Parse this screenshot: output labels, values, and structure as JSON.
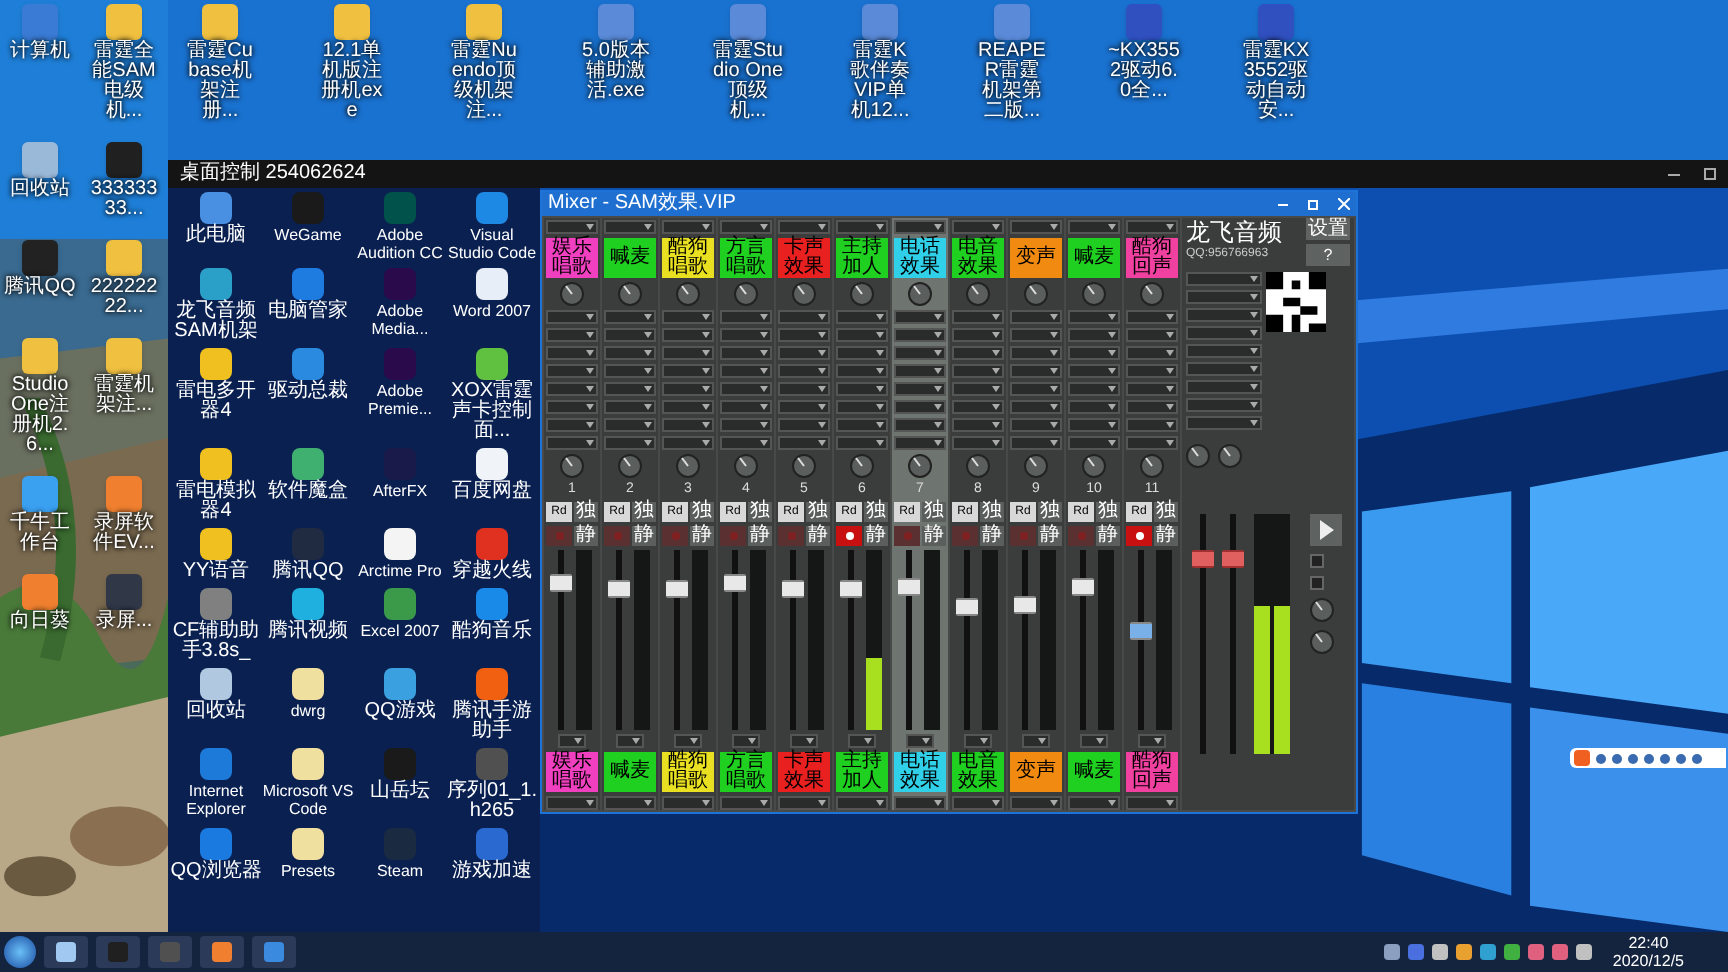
{
  "left_icons": [
    {
      "label": "计算机",
      "color": "#3a7bd5"
    },
    {
      "label": "雷霆全能SAM电级机...",
      "color": "#f0c040"
    },
    {
      "label": "回收站",
      "color": "#9ab8d8"
    },
    {
      "label": "33333333...",
      "color": "#202020"
    },
    {
      "label": "腾讯QQ",
      "color": "#222222"
    },
    {
      "label": "22222222...",
      "color": "#f0c040"
    },
    {
      "label": "Studio One注册机2.6...",
      "color": "#f0c040"
    },
    {
      "label": "雷霆机架注...",
      "color": "#f0c040"
    },
    {
      "label": "千牛工作台",
      "color": "#3aa0f0"
    },
    {
      "label": "录屏软件EV...",
      "color": "#f08030"
    },
    {
      "label": "向日葵",
      "color": "#f08030"
    },
    {
      "label": "录屏...",
      "color": "#303848"
    }
  ],
  "top_icons": [
    {
      "label": "雷霆Cubase机架注册...",
      "color": "#f0c040"
    },
    {
      "label": "12.1单机版注册机exe",
      "color": "#f0c040"
    },
    {
      "label": "雷霆Nuendo顶级机架注...",
      "color": "#f0c040"
    },
    {
      "label": "5.0版本辅助激活.exe",
      "color": "#5a8ad8"
    },
    {
      "label": "雷霆Studio One顶级机...",
      "color": "#5a8ad8"
    },
    {
      "label": "雷霆K歌伴奏VIP单机12...",
      "color": "#5a8ad8"
    },
    {
      "label": "REAPER雷霆机架第二版...",
      "color": "#5a8ad8"
    },
    {
      "label": "~KX3552驱动6.0全...",
      "color": "#3050c0"
    },
    {
      "label": "雷霆KX3552驱动自动安...",
      "color": "#3050c0"
    }
  ],
  "remote_window": {
    "title": "桌面控制 254062624"
  },
  "remote_icons": [
    {
      "label": "此电脑",
      "color": "#4a90e2"
    },
    {
      "label": "WeGame",
      "color": "#1a1a1a"
    },
    {
      "label": "Adobe Audition CC",
      "color": "#00524a"
    },
    {
      "label": "Visual Studio Code",
      "color": "#1e88e5"
    },
    {
      "label": "龙飞音频SAM机架",
      "color": "#2aa0c8"
    },
    {
      "label": "电脑管家",
      "color": "#1e7be0"
    },
    {
      "label": "Adobe Media...",
      "color": "#2a0a4a"
    },
    {
      "label": "Word 2007",
      "color": "#e8eef8"
    },
    {
      "label": "雷电多开器4",
      "color": "#f0c020"
    },
    {
      "label": "驱动总裁",
      "color": "#2a8ae0"
    },
    {
      "label": "Adobe Premie...",
      "color": "#2a0a4a"
    },
    {
      "label": "XOX雷霆声卡控制面...",
      "color": "#60c040"
    },
    {
      "label": "雷电模拟器4",
      "color": "#f0c020"
    },
    {
      "label": "软件魔盒",
      "color": "#40b070"
    },
    {
      "label": "AfterFX",
      "color": "#1a1a4a"
    },
    {
      "label": "百度网盘",
      "color": "#f0f4f8"
    },
    {
      "label": "YY语音",
      "color": "#f0c020"
    },
    {
      "label": "腾讯QQ",
      "color": "#202a40"
    },
    {
      "label": "Arctime Pro",
      "color": "#f4f4f4"
    },
    {
      "label": "穿越火线",
      "color": "#e03020"
    },
    {
      "label": "CF辅助助手3.8s_",
      "color": "#808080"
    },
    {
      "label": "腾讯视频",
      "color": "#20b0e0"
    },
    {
      "label": "Excel 2007",
      "color": "#3a9a4a"
    },
    {
      "label": "酷狗音乐",
      "color": "#1a8ae8"
    },
    {
      "label": "回收站",
      "color": "#b0c8e0"
    },
    {
      "label": "dwrg",
      "color": "#f0e0a0"
    },
    {
      "label": "QQ游戏",
      "color": "#3aa0e0"
    },
    {
      "label": "腾讯手游助手",
      "color": "#f06010"
    },
    {
      "label": "Internet Explorer",
      "color": "#1e7ad8"
    },
    {
      "label": "Microsoft VS Code",
      "color": "#f0e0a0"
    },
    {
      "label": "山岳坛",
      "color": "#1a1a1a"
    },
    {
      "label": "序列01_1.h265",
      "color": "#505050"
    },
    {
      "label": "QQ浏览器",
      "color": "#1a7ae0"
    },
    {
      "label": "Presets",
      "color": "#f0e0a0"
    },
    {
      "label": "Steam",
      "color": "#1a2a40"
    },
    {
      "label": "游戏加速",
      "color": "#2a6ad0"
    }
  ],
  "mixer": {
    "title": "Mixer - SAM效果.VIP",
    "brand": "龙飞音频",
    "brand_qq": "QQ:956766963",
    "settings_button": "设置",
    "help_button": "?",
    "channels": [
      {
        "name": "娱乐唱歌",
        "name_bottom": "娱乐唱歌",
        "color": "#f040c0",
        "number": "1",
        "rec": "Rd",
        "solo": "独",
        "mute": "静",
        "armed": false,
        "selected": false,
        "fader": {
          "level": 0.82
        }
      },
      {
        "name": "喊麦",
        "name_bottom": "喊麦",
        "color": "#20d020",
        "number": "2",
        "rec": "Rd",
        "solo": "独",
        "mute": "静",
        "armed": false,
        "selected": false,
        "fader": {
          "level": 0.78
        }
      },
      {
        "name": "酷狗唱歌",
        "name_bottom": "酷狗唱歌",
        "color": "#e8e020",
        "number": "3",
        "rec": "Rd",
        "solo": "独",
        "mute": "静",
        "armed": false,
        "selected": false,
        "fader": {
          "level": 0.78
        }
      },
      {
        "name": "方言唱歌",
        "name_bottom": "方言唱歌",
        "color": "#20d020",
        "number": "4",
        "rec": "Rd",
        "solo": "独",
        "mute": "静",
        "armed": false,
        "selected": false,
        "fader": {
          "level": 0.82
        }
      },
      {
        "name": "卡声效果",
        "name_bottom": "卡声效果",
        "color": "#e82020",
        "number": "5",
        "rec": "Rd",
        "solo": "独",
        "mute": "静",
        "armed": false,
        "selected": false,
        "fader": {
          "level": 0.78
        }
      },
      {
        "name": "主持加人",
        "name_bottom": "主持加人",
        "color": "#20d020",
        "number": "6",
        "rec": "Rd",
        "solo": "独",
        "mute": "静",
        "armed": true,
        "selected": false,
        "fader": {
          "level": 0.78
        },
        "meter": {
          "level": 0.4
        }
      },
      {
        "name": "电话效果",
        "name_bottom": "电话效果",
        "color": "#30d0e8",
        "number": "7",
        "rec": "Rd",
        "solo": "独",
        "mute": "静",
        "armed": false,
        "selected": true,
        "fader": {
          "level": 0.8
        }
      },
      {
        "name": "电音效果",
        "name_bottom": "电音效果",
        "color": "#20d020",
        "number": "8",
        "rec": "Rd",
        "solo": "独",
        "mute": "静",
        "armed": false,
        "selected": false,
        "fader": {
          "level": 0.68
        }
      },
      {
        "name": "变声",
        "name_bottom": "变声",
        "color": "#f08a10",
        "number": "9",
        "rec": "Rd",
        "solo": "独",
        "mute": "静",
        "armed": false,
        "selected": false,
        "fader": {
          "level": 0.7
        }
      },
      {
        "name": "喊麦",
        "name_bottom": "喊麦",
        "color": "#20d020",
        "number": "10",
        "rec": "Rd",
        "solo": "独",
        "mute": "静",
        "armed": false,
        "selected": false,
        "fader": {
          "level": 0.8
        }
      },
      {
        "name": "酷狗回声",
        "name_bottom": "酷狗回声",
        "color": "#f040a0",
        "number": "11",
        "rec": "Rd",
        "solo": "独",
        "mute": "静",
        "armed": true,
        "selected": false,
        "fader": {
          "level": 0.55
        }
      }
    ],
    "master": {
      "left": {
        "level": 0.85
      },
      "right": {
        "level": 0.85
      },
      "meter": {
        "level": 0.62
      },
      "options": [
        {
          "checked": false
        },
        {
          "checked": false
        }
      ]
    }
  },
  "taskbar": {
    "time": "22:40",
    "date": "2020/12/5"
  }
}
